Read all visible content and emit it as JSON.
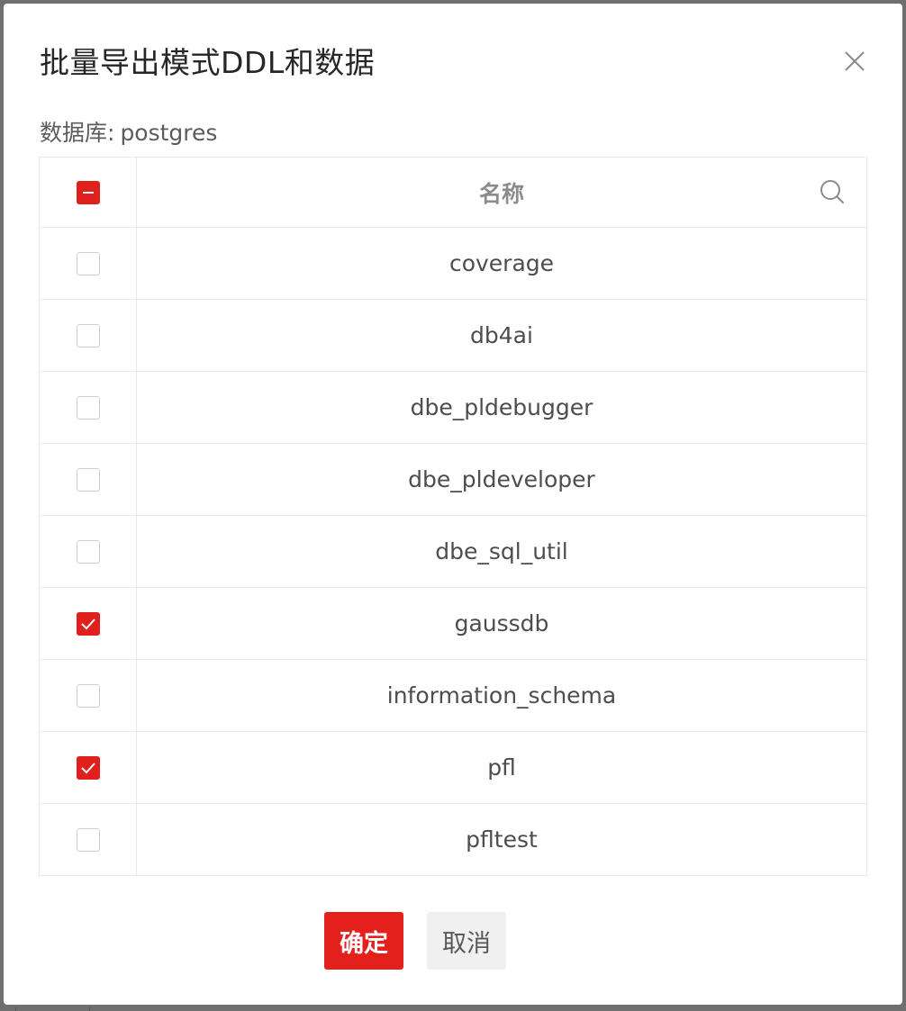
{
  "dialog": {
    "title": "批量导出模式DDL和数据",
    "close_icon": "close-icon"
  },
  "database": {
    "label": "数据库:",
    "name": "postgres"
  },
  "table": {
    "header": {
      "select_all_state": "indeterminate",
      "name_column": "名称",
      "search_icon": "search-icon"
    },
    "rows": [
      {
        "name": "coverage",
        "checked": false
      },
      {
        "name": "db4ai",
        "checked": false
      },
      {
        "name": "dbe_pldebugger",
        "checked": false
      },
      {
        "name": "dbe_pldeveloper",
        "checked": false
      },
      {
        "name": "dbe_sql_util",
        "checked": false
      },
      {
        "name": "gaussdb",
        "checked": true
      },
      {
        "name": "information_schema",
        "checked": false
      },
      {
        "name": "pfl",
        "checked": true
      },
      {
        "name": "pfltest",
        "checked": false
      }
    ]
  },
  "footer": {
    "confirm_label": "确定",
    "cancel_label": "取消"
  },
  "colors": {
    "accent": "#e3201c",
    "border": "#e8e8e8"
  }
}
